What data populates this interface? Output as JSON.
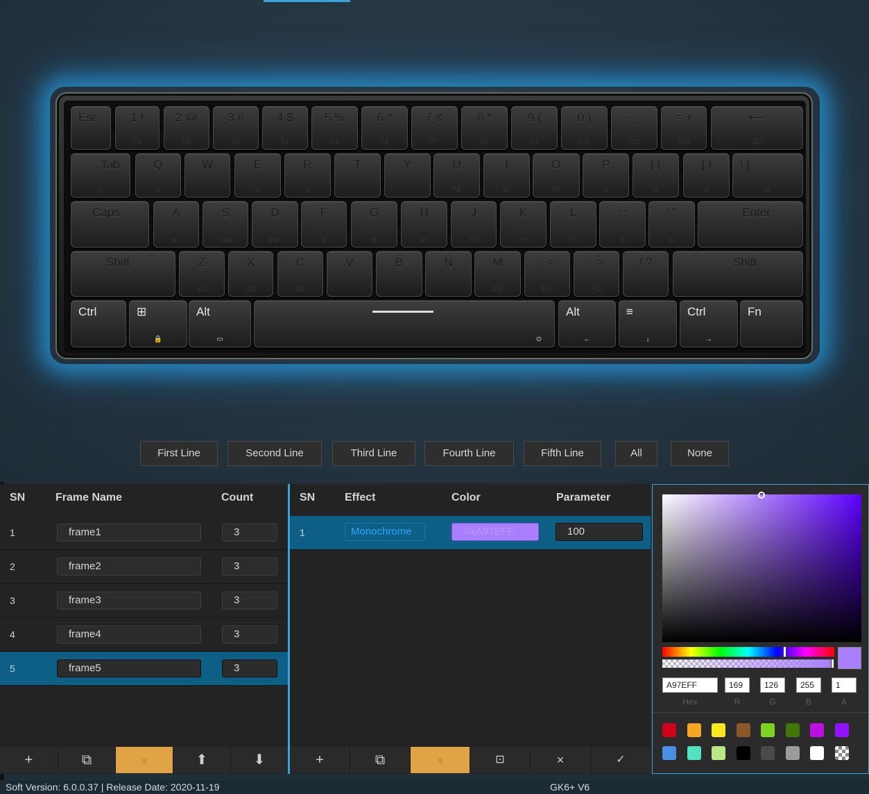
{
  "keyboard": {
    "row1": [
      {
        "main": "Esc",
        "sub": ""
      },
      {
        "main": "1 !",
        "sub": "F1"
      },
      {
        "main": "2 @",
        "sub": "F2"
      },
      {
        "main": "3 #",
        "sub": "F3"
      },
      {
        "main": "4 $",
        "sub": "F4"
      },
      {
        "main": "5 %",
        "sub": "F5"
      },
      {
        "main": "6 ^",
        "sub": "F6"
      },
      {
        "main": "7 &",
        "sub": "F7"
      },
      {
        "main": "8 *",
        "sub": "F8"
      },
      {
        "main": "9 (",
        "sub": "F9"
      },
      {
        "main": "0 )",
        "sub": "F10"
      },
      {
        "main": "- _",
        "sub": "F11"
      },
      {
        "main": "= +",
        "sub": "F12"
      },
      {
        "main": "⟵",
        "sub": "⌦"
      }
    ],
    "row2": [
      {
        "main": "Tab",
        "sub": "◎"
      },
      {
        "main": "Q",
        "sub": "◎"
      },
      {
        "main": "W",
        "sub": "↑"
      },
      {
        "main": "E",
        "sub": "◎"
      },
      {
        "main": "R",
        "sub": "◎"
      },
      {
        "main": "T",
        "sub": ""
      },
      {
        "main": "Y",
        "sub": ""
      },
      {
        "main": "U",
        "sub": "PS"
      },
      {
        "main": "I",
        "sub": "SL"
      },
      {
        "main": "O",
        "sub": "PB"
      },
      {
        "main": "P",
        "sub": "◎"
      },
      {
        "main": "[ {",
        "sub": "◎"
      },
      {
        "main": "] }",
        "sub": "◎"
      },
      {
        "main": "\\ |",
        "sub": "◎"
      }
    ],
    "row3": [
      {
        "main": "Caps",
        "sub": ""
      },
      {
        "main": "A",
        "sub": "▶||"
      },
      {
        "main": "S",
        "sub": "|◀◀"
      },
      {
        "main": "D",
        "sub": "▶▶|"
      },
      {
        "main": "F",
        "sub": "◀"
      },
      {
        "main": "G",
        "sub": "◀-"
      },
      {
        "main": "H",
        "sub": "◀+"
      },
      {
        "main": "J",
        "sub": "INS"
      },
      {
        "main": "K",
        "sub": "HM"
      },
      {
        "main": "L",
        "sub": "PU"
      },
      {
        "main": "; :",
        "sub": "◎"
      },
      {
        "main": "' \"",
        "sub": "◎"
      },
      {
        "main": "Enter",
        "sub": ""
      }
    ],
    "row4": [
      {
        "main": "Shift",
        "sub": ""
      },
      {
        "main": "Z",
        "sub": "◎1"
      },
      {
        "main": "X",
        "sub": "◎2"
      },
      {
        "main": "C",
        "sub": "◎3"
      },
      {
        "main": "V",
        "sub": ""
      },
      {
        "main": "B",
        "sub": ""
      },
      {
        "main": "N",
        "sub": ""
      },
      {
        "main": "M",
        "sub": "Del"
      },
      {
        "main": ", <",
        "sub": "End"
      },
      {
        "main": ". >",
        "sub": "PD"
      },
      {
        "main": "/ ?",
        "sub": "↑"
      },
      {
        "main": "Shift",
        "sub": ""
      }
    ],
    "row5": [
      {
        "main": "Ctrl",
        "sub": ""
      },
      {
        "main": "⊞",
        "sub": "🔒"
      },
      {
        "main": "Alt",
        "sub": "▭"
      },
      {
        "main": "",
        "sub": "⊙"
      },
      {
        "main": "Alt",
        "sub": "←"
      },
      {
        "main": "≡",
        "sub": "↓"
      },
      {
        "main": "Ctrl",
        "sub": "→"
      },
      {
        "main": "Fn",
        "sub": ""
      }
    ]
  },
  "line_buttons": [
    "First Line",
    "Second Line",
    "Third Line",
    "Fourth Line",
    "Fifth Line",
    "All",
    "None"
  ],
  "frames_table": {
    "headers": {
      "sn": "SN",
      "name": "Frame Name",
      "count": "Count"
    },
    "rows": [
      {
        "sn": "1",
        "name": "frame1",
        "count": "3"
      },
      {
        "sn": "2",
        "name": "frame2",
        "count": "3"
      },
      {
        "sn": "3",
        "name": "frame3",
        "count": "3"
      },
      {
        "sn": "4",
        "name": "frame4",
        "count": "3"
      },
      {
        "sn": "5",
        "name": "frame5",
        "count": "3"
      }
    ],
    "selected_index": 4
  },
  "effects_table": {
    "headers": {
      "sn": "SN",
      "effect": "Effect",
      "color": "Color",
      "parameter": "Parameter"
    },
    "rows": [
      {
        "sn": "1",
        "effect": "Monochrome",
        "color": "0xA97EFF",
        "parameter": "100"
      }
    ]
  },
  "picker": {
    "hex": "A97EFF",
    "r": "169",
    "g": "126",
    "b": "255",
    "a": "1",
    "labels": {
      "hex": "Hex",
      "r": "R",
      "g": "G",
      "b": "B",
      "a": "A"
    },
    "current_color": "#a97eff",
    "swatches": [
      "#d0021b",
      "#f5a623",
      "#f8e71c",
      "#8b572a",
      "#7ed321",
      "#417505",
      "#bd10e0",
      "#9013fe",
      "#4a90e2",
      "#50e3c2",
      "#b8e986",
      "#000000",
      "#4a4a4a",
      "#9b9b9b",
      "#ffffff",
      "transparent"
    ]
  },
  "toolbars": {
    "left": [
      {
        "icon": "plus-icon",
        "glyph": "+"
      },
      {
        "icon": "copy-icon",
        "glyph": "⧉"
      },
      {
        "icon": "delete-icon",
        "glyph": ""
      },
      {
        "icon": "arrow-up-icon",
        "glyph": "⬆"
      },
      {
        "icon": "arrow-down-icon",
        "glyph": "⬇"
      }
    ],
    "right": [
      {
        "icon": "plus-icon",
        "glyph": "+"
      },
      {
        "icon": "copy-icon",
        "glyph": "⧉"
      },
      {
        "icon": "delete-icon",
        "glyph": ""
      },
      {
        "icon": "preview-icon",
        "glyph": "⊡"
      },
      {
        "icon": "close-icon",
        "glyph": "×"
      },
      {
        "icon": "check-icon",
        "glyph": "✓"
      }
    ]
  },
  "status": {
    "version": "Soft Version: 6.0.0.37 |  Release Date: 2020-11-19",
    "model": "GK6+ V6"
  }
}
